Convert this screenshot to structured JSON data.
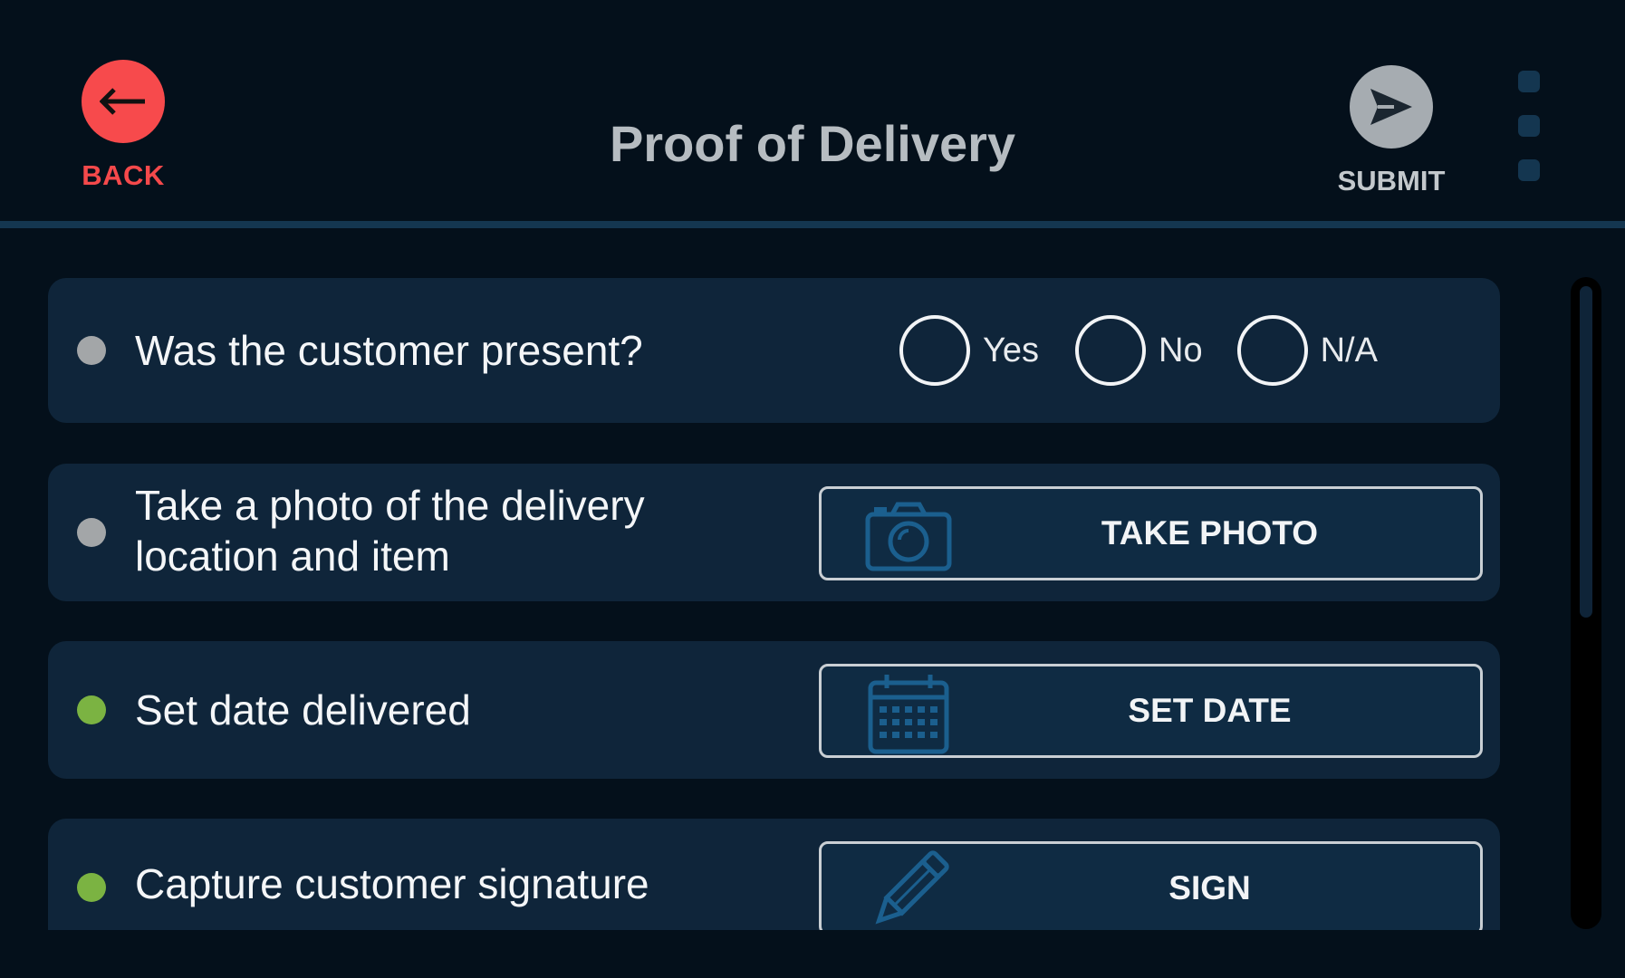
{
  "header": {
    "title": "Proof of Delivery",
    "back_label": "BACK",
    "submit_label": "SUBMIT",
    "back_icon": "arrow-left-icon",
    "submit_icon": "send-icon",
    "menu_icon": "more-vertical-icon"
  },
  "items": [
    {
      "label": "Was the customer present?",
      "status": "incomplete",
      "status_color": "#a3a6a8",
      "type": "radio",
      "options": [
        "Yes",
        "No",
        "N/A"
      ]
    },
    {
      "label_line1": "Take a photo of the delivery",
      "label_line2": "location and item",
      "status": "incomplete",
      "status_color": "#a3a6a8",
      "type": "button",
      "button_label": "TAKE PHOTO",
      "icon": "camera-icon"
    },
    {
      "label": "Set date delivered",
      "status": "complete",
      "status_color": "#7bb342",
      "type": "button",
      "button_label": "SET DATE",
      "icon": "calendar-icon"
    },
    {
      "label": "Capture customer signature",
      "status": "complete",
      "status_color": "#7bb342",
      "type": "button",
      "button_label": "SIGN",
      "icon": "pencil-icon"
    }
  ],
  "colors": {
    "background": "#04101b",
    "card": "#0f253a",
    "accent_red": "#f74a4c",
    "icon_blue": "#1b5f8e"
  }
}
